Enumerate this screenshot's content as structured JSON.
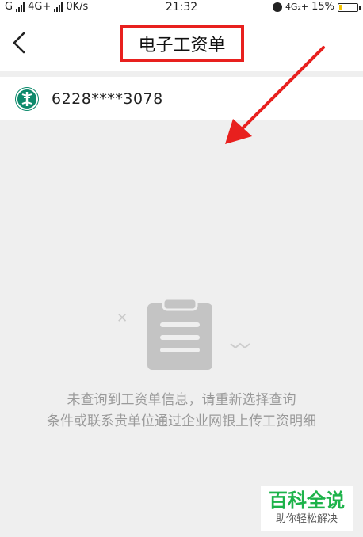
{
  "status_bar": {
    "carrier_left": "G",
    "network": "4G+",
    "speed": "0K/s",
    "time": "21:32",
    "network_right": "4G₂+",
    "battery": "15%"
  },
  "header": {
    "title": "电子工资单"
  },
  "card": {
    "number": "6228****3078"
  },
  "empty_state": {
    "line1": "未查询到工资单信息，请重新选择查询",
    "line2": "条件或联系贵单位通过企业网银上传工资明细"
  },
  "watermark": {
    "title": "百科全说",
    "subtitle": "助你轻松解决"
  },
  "colors": {
    "highlight": "#e8201e",
    "bank": "#0e8a6c",
    "watermark": "#1db34a"
  }
}
